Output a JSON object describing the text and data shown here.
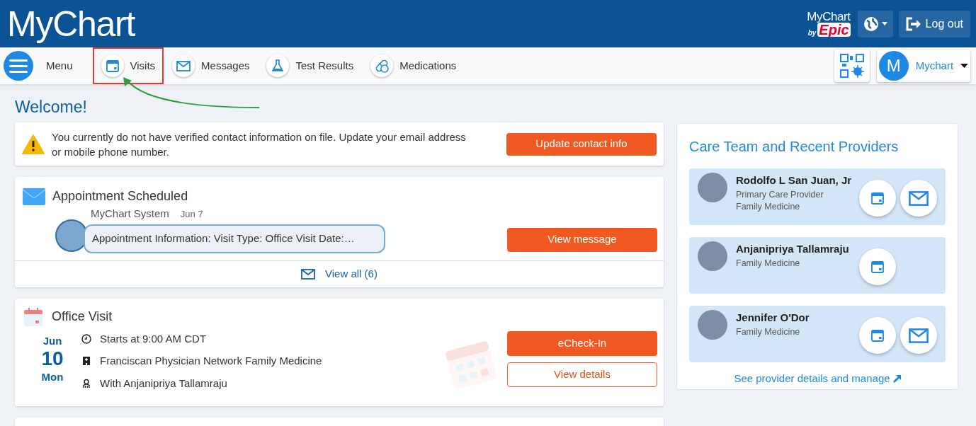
{
  "header": {
    "logo": "MyChart",
    "brand_logo": {
      "name": "MyChart",
      "by": "by",
      "maker": "Epic"
    },
    "logout": "Log out"
  },
  "nav": {
    "menu": "Menu",
    "items": [
      {
        "kind": "calendar",
        "label": "Visits",
        "highlighted": true
      },
      {
        "kind": "mail",
        "label": "Messages",
        "highlighted": false
      },
      {
        "kind": "flask",
        "label": "Test Results",
        "highlighted": false
      },
      {
        "kind": "pill",
        "label": "Medications",
        "highlighted": false
      }
    ],
    "user": {
      "initial": "M",
      "name": "Mychart"
    }
  },
  "welcome": "Welcome!",
  "alert": {
    "text": "You currently do not have verified contact information on file. Update your email address or mobile phone number.",
    "button": "Update contact info"
  },
  "message_card": {
    "title": "Appointment Scheduled",
    "sender": "MyChart System",
    "date": "Jun 7",
    "preview": "Appointment Information: Visit Type: Office Visit Date:…",
    "button": "View message",
    "view_all": "View all (6)"
  },
  "visit_card": {
    "title": "Office Visit",
    "month": "Jun",
    "day": "10",
    "weekday": "Mon",
    "details": [
      {
        "kind": "clock",
        "text": "Starts at 9:00 AM CDT"
      },
      {
        "kind": "clinic",
        "text": "Franciscan Physician Network Family Medicine"
      },
      {
        "kind": "person",
        "text": "With Anjanipriya Tallamraju"
      }
    ],
    "primary_button": "eCheck-In",
    "secondary_button": "View details"
  },
  "care_team": {
    "title": "Care Team and Recent Providers",
    "providers": [
      {
        "name": "Rodolfo L San Juan, Jr",
        "roles": [
          "Primary Care Provider",
          "Family Medicine"
        ],
        "can_message": true
      },
      {
        "name": "Anjanipriya Tallamraju",
        "roles": [
          "Family Medicine"
        ],
        "can_message": false
      },
      {
        "name": "Jennifer O'Dor",
        "roles": [
          "Family Medicine"
        ],
        "can_message": true
      }
    ],
    "link": "See provider details and manage"
  }
}
